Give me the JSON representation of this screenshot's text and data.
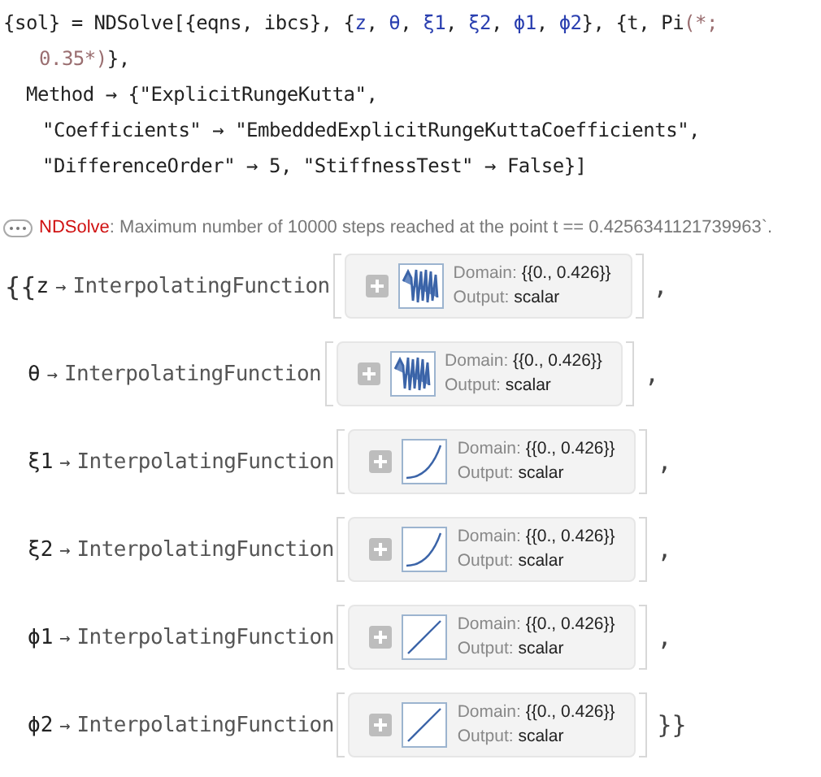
{
  "input": {
    "lines": [
      {
        "tokens": [
          {
            "text": "{sol} = NDSolve[{eqns, ibcs}, {",
            "kind": "plain"
          },
          {
            "text": "z",
            "kind": "variable"
          },
          {
            "text": ", ",
            "kind": "plain"
          },
          {
            "text": "θ",
            "kind": "variable"
          },
          {
            "text": ", ",
            "kind": "plain"
          },
          {
            "text": "ξ1",
            "kind": "variable"
          },
          {
            "text": ", ",
            "kind": "plain"
          },
          {
            "text": "ξ2",
            "kind": "variable"
          },
          {
            "text": ", ",
            "kind": "plain"
          },
          {
            "text": "ϕ1",
            "kind": "variable"
          },
          {
            "text": ", ",
            "kind": "plain"
          },
          {
            "text": "ϕ2",
            "kind": "variable"
          },
          {
            "text": "}, {t, Pi",
            "kind": "plain"
          },
          {
            "text": "(*;",
            "kind": "comment"
          }
        ]
      },
      {
        "tokens": [
          {
            "text": "0.35*)",
            "kind": "comment"
          },
          {
            "text": "},",
            "kind": "plain"
          }
        ]
      },
      {
        "tokens": [
          {
            "text": "Method → {\"ExplicitRungeKutta\",",
            "kind": "plain"
          }
        ]
      },
      {
        "tokens": [
          {
            "text": "\"Coefficients\" → \"EmbeddedExplicitRungeKuttaCoefficients\",",
            "kind": "plain"
          }
        ]
      },
      {
        "tokens": [
          {
            "text": "\"DifferenceOrder\" → 5, \"StiffnessTest\" → False}]",
            "kind": "plain"
          }
        ]
      }
    ]
  },
  "message": {
    "symbol": "NDSolve",
    "separator": ":",
    "text": "Maximum number of 10000 steps reached at the point t == 0.4256341121739963`."
  },
  "result": {
    "rules": [
      {
        "prefix": "{{",
        "symbol": "z",
        "arrow": "→",
        "head": "InterpolatingFunction",
        "domain_label": "Domain:",
        "domain": "{{0., 0.426}}",
        "output_label": "Output:",
        "output": "scalar",
        "kind": "oscillating",
        "suffix": ","
      },
      {
        "symbol": "θ",
        "arrow": "→",
        "head": "InterpolatingFunction",
        "domain_label": "Domain:",
        "domain": "{{0., 0.426}}",
        "output_label": "Output:",
        "output": "scalar",
        "kind": "oscillating",
        "suffix": ","
      },
      {
        "symbol": "ξ1",
        "arrow": "→",
        "head": "InterpolatingFunction",
        "domain_label": "Domain:",
        "domain": "{{0., 0.426}}",
        "output_label": "Output:",
        "output": "scalar",
        "kind": "curve",
        "suffix": ","
      },
      {
        "symbol": "ξ2",
        "arrow": "→",
        "head": "InterpolatingFunction",
        "domain_label": "Domain:",
        "domain": "{{0., 0.426}}",
        "output_label": "Output:",
        "output": "scalar",
        "kind": "curve",
        "suffix": ","
      },
      {
        "symbol": "ϕ1",
        "arrow": "→",
        "head": "InterpolatingFunction",
        "domain_label": "Domain:",
        "domain": "{{0., 0.426}}",
        "output_label": "Output:",
        "output": "scalar",
        "kind": "line",
        "suffix": ","
      },
      {
        "symbol": "ϕ2",
        "arrow": "→",
        "head": "InterpolatingFunction",
        "domain_label": "Domain:",
        "domain": "{{0., 0.426}}",
        "output_label": "Output:",
        "output": "scalar",
        "kind": "line",
        "suffix": "}}"
      }
    ]
  }
}
